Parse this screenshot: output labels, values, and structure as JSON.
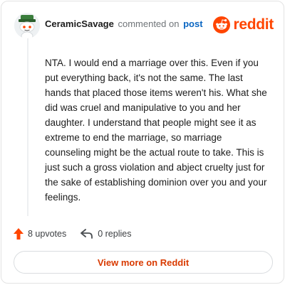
{
  "comment": {
    "username": "CeramicSavage",
    "verb": "commented on",
    "target": "post",
    "body": "NTA. I would end a marriage over this. Even if you put everything back, it's not the same. The last hands that placed those items weren't his. What she did was cruel and manipulative to you and her daughter. I understand that people might see it as extreme to end the marriage, so marriage counseling might be the actual route to take. This is just such a gross violation and abject cruelty just for the sake of establishing dominion over you and your feelings."
  },
  "brand": {
    "wordmark": "reddit",
    "logo_icon": "reddit-snoo-icon",
    "color": "#ff4500"
  },
  "actions": {
    "upvotes_label": "8 upvotes",
    "upvote_icon": "upvote-arrow-icon",
    "upvote_color": "#ff4500",
    "replies_label": "0 replies",
    "reply_icon": "reply-arrow-icon"
  },
  "cta": {
    "label": "View more on Reddit",
    "color": "#d93a00"
  }
}
